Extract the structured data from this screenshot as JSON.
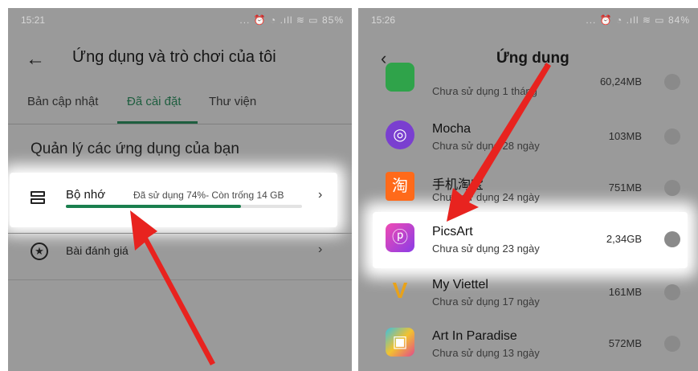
{
  "left": {
    "status_time": "15:21",
    "status_icons": "... ⏰ ◔ .ıll ≋ ▭ 85%",
    "title": "Ứng dụng và trò chơi của tôi",
    "tabs": [
      {
        "label": "Bản cập nhật"
      },
      {
        "label": "Đã cài đặt"
      },
      {
        "label": "Thư viện"
      }
    ],
    "section_title": "Quản lý các ứng dụng của bạn",
    "storage": {
      "label": "Bộ nhớ",
      "detail": "Đã sử dụng 74%- Còn trống 14 GB",
      "used_fraction": 0.74
    },
    "rating": {
      "label": "Bài đánh giá"
    }
  },
  "right": {
    "status_time": "15:26",
    "status_icons": "... ⏰ ◔ .ıll ≋ ▭ 84%",
    "title": "Ứng dụng",
    "apps": [
      {
        "name": "",
        "sub": "Chưa sử dụng 1 tháng",
        "size": "60,24MB",
        "icon": "green-app-icon",
        "color": "#2fa34a"
      },
      {
        "name": "Mocha",
        "sub": "Chưa sử dụng 28 ngày",
        "size": "103MB",
        "icon": "mocha-icon",
        "color": "#7a3fd0"
      },
      {
        "name": "手机淘宝",
        "sub": "Chưa sử dụng 24 ngày",
        "size": "751MB",
        "icon": "taobao-icon",
        "color": "#ff6a1a"
      },
      {
        "name": "PicsArt",
        "sub": "Chưa sử dụng 23 ngày",
        "size": "2,34GB",
        "icon": "picsart-icon",
        "color": "#c43be0"
      },
      {
        "name": "My Viettel",
        "sub": "Chưa sử dụng 17 ngày",
        "size": "161MB",
        "icon": "my-viettel-icon",
        "color": "#f3b11b"
      },
      {
        "name": "Art In Paradise",
        "sub": "Chưa sử dụng 13 ngày",
        "size": "572MB",
        "icon": "art-in-paradise-icon",
        "color": "#3bbfe0"
      }
    ]
  },
  "colors": {
    "accent_green": "#1a7f4e",
    "arrow_red": "#e8231f"
  }
}
